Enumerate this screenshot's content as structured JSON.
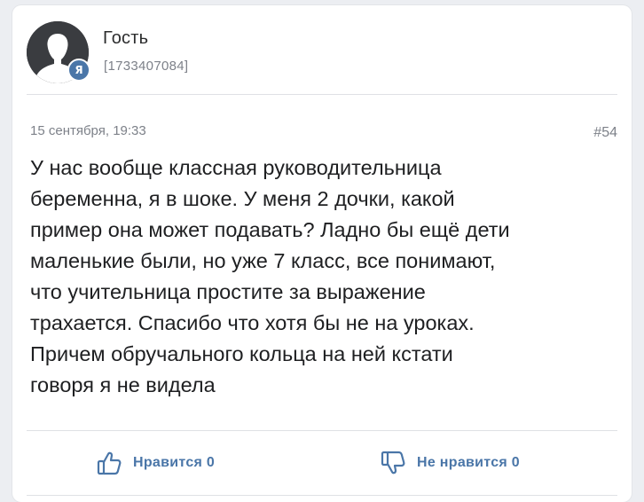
{
  "author": {
    "name": "Гость",
    "id": "[1733407084]",
    "badge": "Я",
    "avatar_icon": "user-silhouette-icon"
  },
  "post": {
    "date": "15 сентября, 19:33",
    "number": "#54",
    "lines": [
      "У нас вообще классная руководительница",
      "беременна, я в шоке. У меня 2 дочки, какой",
      "пример она может подавать? Ладно бы ещё дети",
      "маленькие были, но уже 7 класс, все понимают,",
      "что учительница простите за выражение",
      "трахается. Спасибо что хотя бы не на уроках.",
      "Причем обручального кольца на ней кстати",
      "говоря я не видела"
    ]
  },
  "actions": {
    "like_label": "Нравится 0",
    "dislike_label": "Не нравится 0",
    "like_icon": "thumbs-up-icon",
    "dislike_icon": "thumbs-down-icon",
    "accent_color": "#4a76a8"
  },
  "colors": {
    "background": "#eceef2",
    "card": "#ffffff",
    "text": "#1e1f21",
    "muted": "#7d8189"
  }
}
